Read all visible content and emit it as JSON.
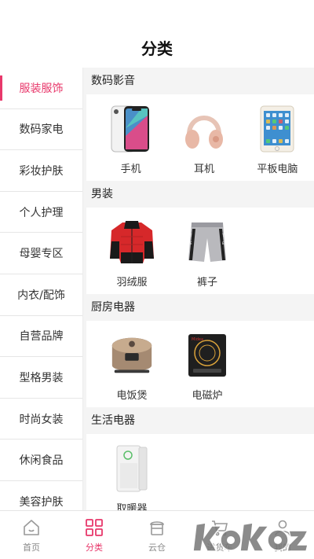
{
  "header": {
    "title": "分类"
  },
  "sidebar": {
    "items": [
      {
        "label": "服装服饰",
        "active": true
      },
      {
        "label": "数码家电"
      },
      {
        "label": "彩妆护肤"
      },
      {
        "label": "个人护理"
      },
      {
        "label": "母婴专区"
      },
      {
        "label": "内衣/配饰"
      },
      {
        "label": "自营品牌"
      },
      {
        "label": "型格男装"
      },
      {
        "label": "时尚女装"
      },
      {
        "label": "休闲食品"
      },
      {
        "label": "美容护肤"
      }
    ]
  },
  "sections": [
    {
      "title": "数码影音",
      "products": [
        {
          "name": "手机",
          "icon": "iphone-x-image"
        },
        {
          "name": "耳机",
          "icon": "headphones-image"
        },
        {
          "name": "平板电脑",
          "icon": "ipad-image"
        }
      ]
    },
    {
      "title": "男装",
      "products": [
        {
          "name": "羽绒服",
          "icon": "down-jacket-image"
        },
        {
          "name": "裤子",
          "icon": "shorts-image"
        }
      ]
    },
    {
      "title": "厨房电器",
      "products": [
        {
          "name": "电饭煲",
          "icon": "rice-cooker-image"
        },
        {
          "name": "电磁炉",
          "icon": "induction-cooker-image"
        }
      ]
    },
    {
      "title": "生活电器",
      "products": [
        {
          "name": "取暖器",
          "icon": "air-purifier-image"
        }
      ]
    }
  ],
  "tabbar": {
    "tabs": [
      {
        "label": "首页",
        "icon": "home-icon"
      },
      {
        "label": "分类",
        "icon": "grid-icon",
        "active": true
      },
      {
        "label": "云仓",
        "icon": "cloud-store-icon"
      },
      {
        "label": "进货车",
        "icon": "cart-icon"
      },
      {
        "label": "我的",
        "icon": "user-icon"
      }
    ]
  },
  "colors": {
    "accent": "#e8386b",
    "background": "#f4f4f4"
  },
  "watermark": {
    "text": "k0k0z"
  }
}
